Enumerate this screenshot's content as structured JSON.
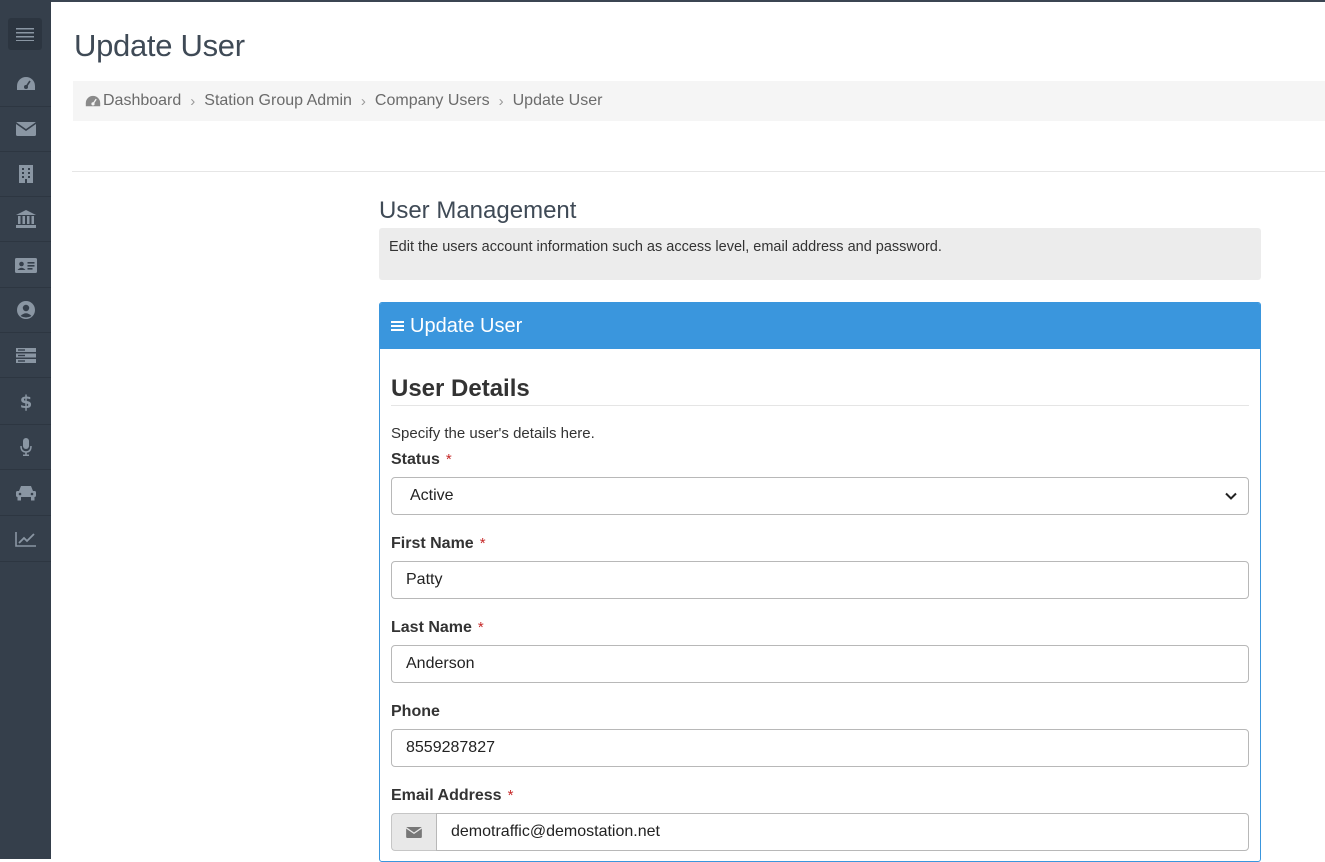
{
  "page": {
    "title": "Update User"
  },
  "sidebar": {
    "toggle_icon": "hamburger-menu-icon",
    "items": [
      {
        "icon": "dashboard-icon"
      },
      {
        "icon": "envelope-icon"
      },
      {
        "icon": "building-icon"
      },
      {
        "icon": "bank-icon"
      },
      {
        "icon": "id-card-icon"
      },
      {
        "icon": "user-circle-icon"
      },
      {
        "icon": "server-icon"
      },
      {
        "icon": "dollar-icon"
      },
      {
        "icon": "microphone-icon"
      },
      {
        "icon": "car-icon"
      },
      {
        "icon": "line-chart-icon"
      }
    ],
    "colors": {
      "background": "#353f4b",
      "icon": "#8a96a3"
    }
  },
  "breadcrumb": {
    "home_icon": "tachometer-icon",
    "items": [
      "Dashboard",
      "Station Group Admin",
      "Company Users",
      "Update User"
    ],
    "separator": "›"
  },
  "section": {
    "title": "User Management",
    "description": "Edit the users account information such as access level, email address and password."
  },
  "panel": {
    "title": "Update User",
    "title_icon": "bars-icon",
    "accent_color": "#3a96dd",
    "details_title": "User Details",
    "helper_text": "Specify the user's details here.",
    "fields": {
      "status": {
        "label": "Status",
        "required_mark": "*",
        "value": "Active"
      },
      "first_name": {
        "label": "First Name",
        "required_mark": "*",
        "value": "Patty"
      },
      "last_name": {
        "label": "Last Name",
        "required_mark": "*",
        "value": "Anderson"
      },
      "phone": {
        "label": "Phone",
        "value": "8559287827"
      },
      "email": {
        "label": "Email Address",
        "required_mark": "*",
        "value": "demotraffic@demostation.net",
        "addon_icon": "envelope-icon"
      }
    }
  }
}
